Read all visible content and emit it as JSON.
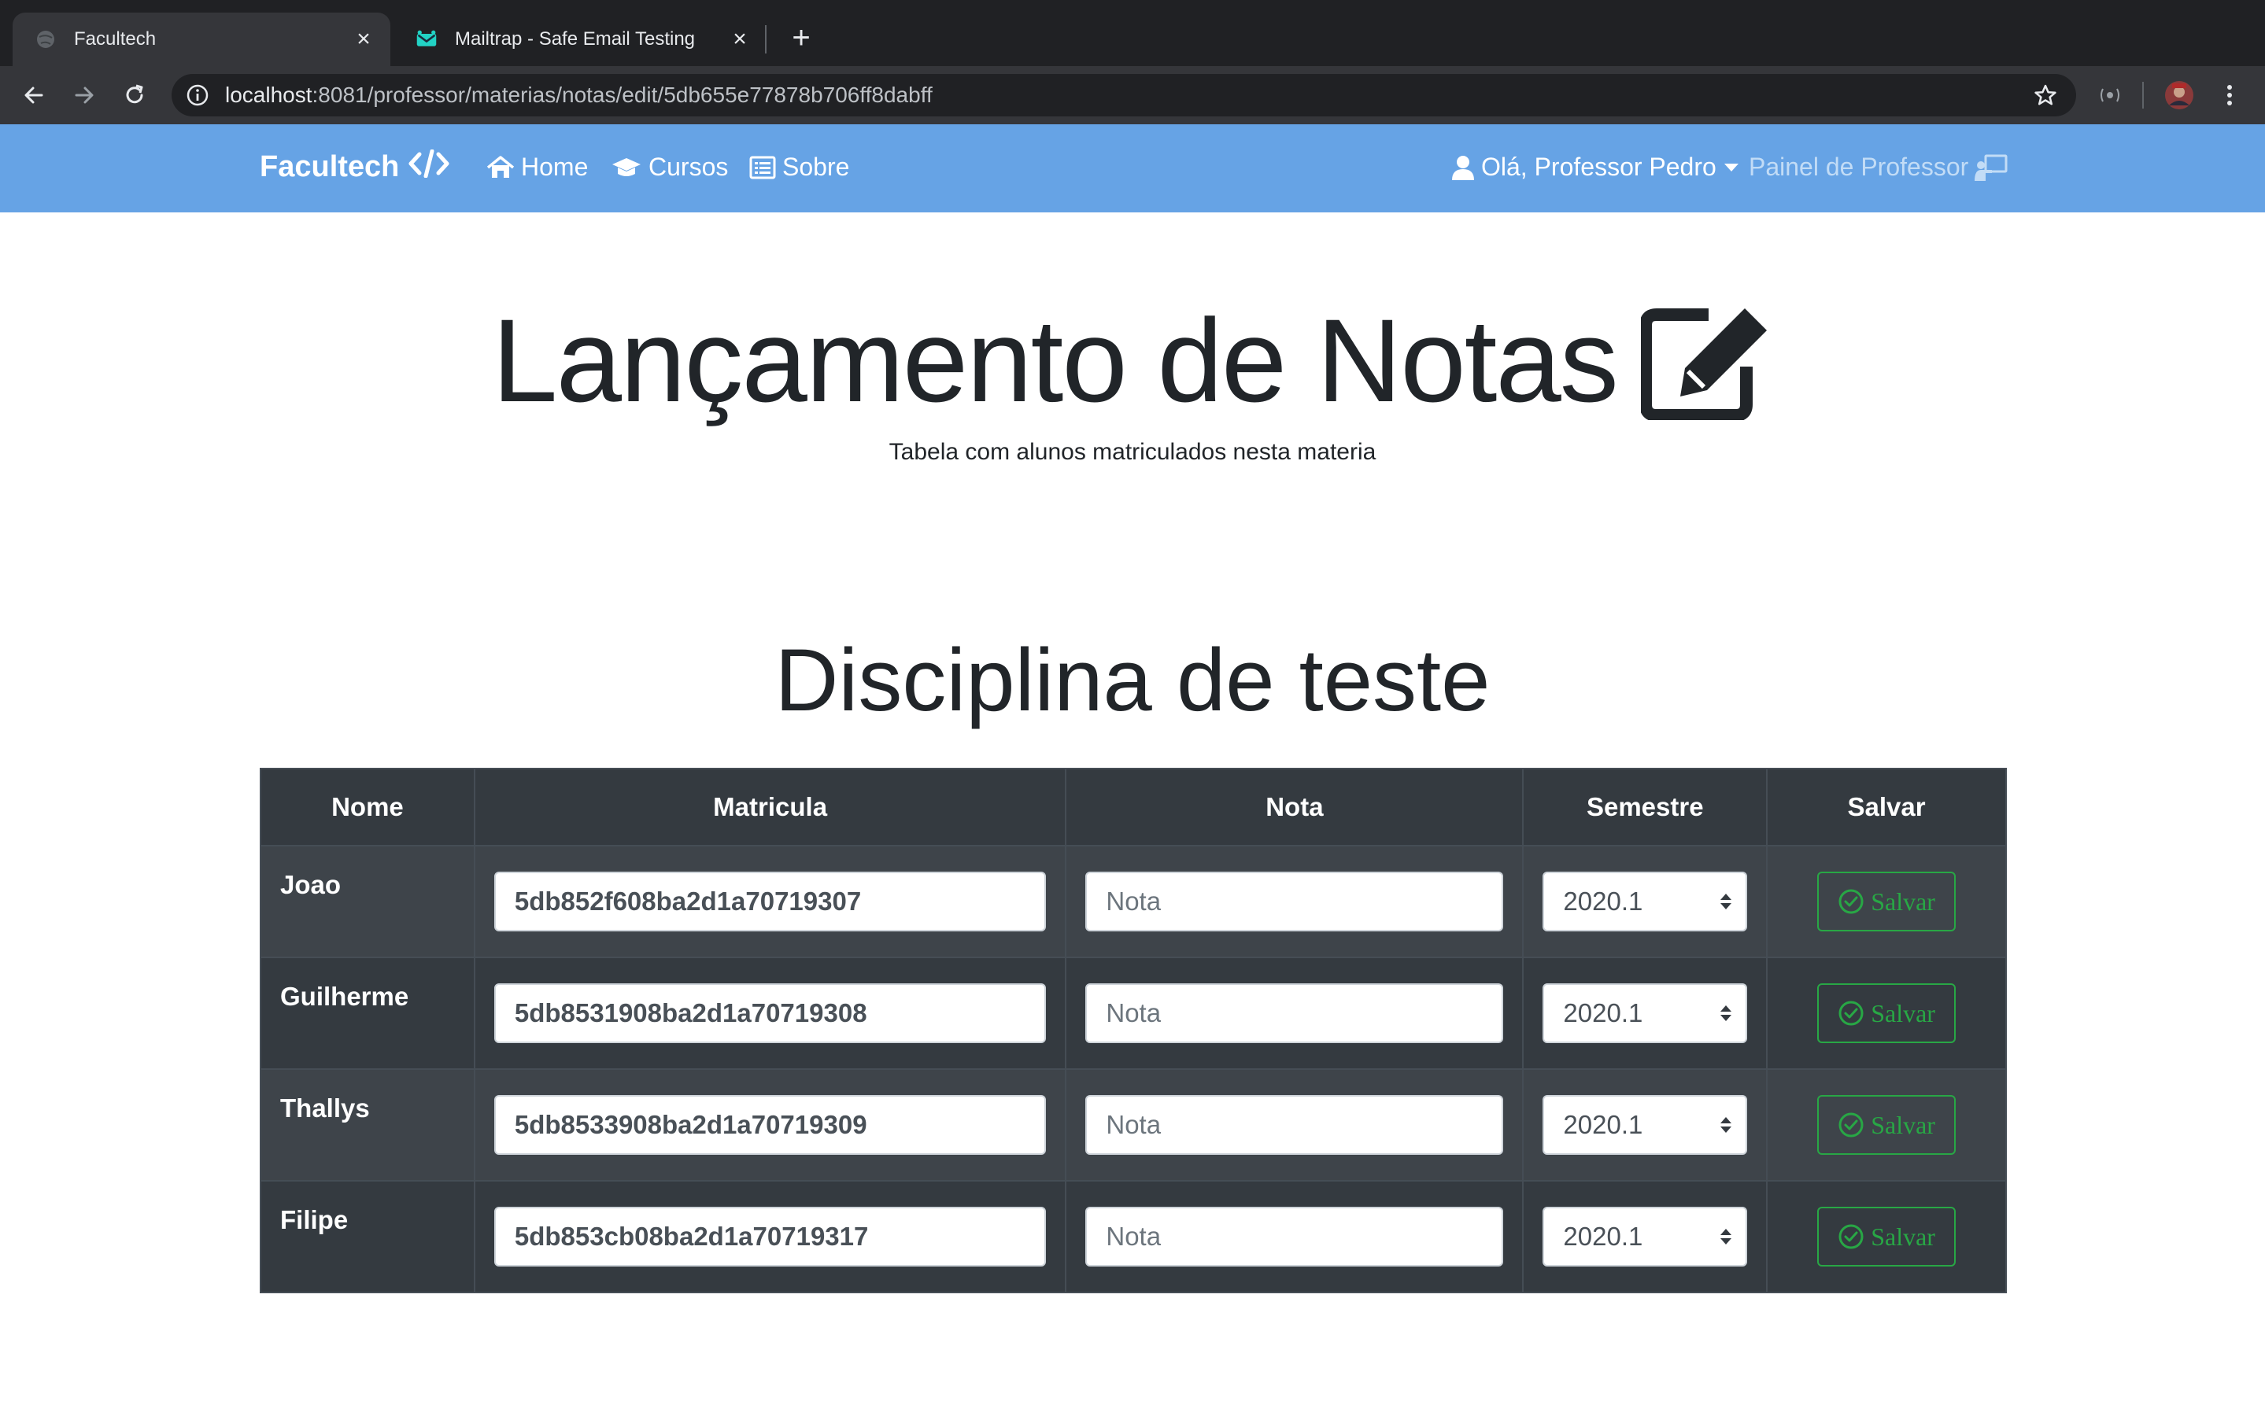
{
  "browser": {
    "tabs": [
      {
        "title": "Facultech",
        "active": true
      },
      {
        "title": "Mailtrap - Safe Email Testing",
        "active": false
      }
    ],
    "url_host": "localhost",
    "url_rest": ":8081/professor/materias/notas/edit/5db655e77878b706ff8dabff"
  },
  "navbar": {
    "brand": "Facultech",
    "links": [
      "Home",
      "Cursos",
      "Sobre"
    ],
    "user_menu": "Olá, Professor Pedro",
    "panel_link": "Painel de Professor",
    "bg_color": "#66a3e5"
  },
  "page": {
    "title": "Lançamento de Notas",
    "subtitle": "Tabela com alunos matriculados nesta materia",
    "discipline": "Disciplina de teste"
  },
  "table": {
    "headers": [
      "Nome",
      "Matricula",
      "Nota",
      "Semestre",
      "Salvar"
    ],
    "rows": [
      {
        "name": "Joao",
        "matricula": "5db852f608ba2d1a70719307",
        "nota_placeholder": "Nota",
        "semestre": "2020.1",
        "save": "Salvar"
      },
      {
        "name": "Guilherme",
        "matricula": "5db8531908ba2d1a70719308",
        "nota_placeholder": "Nota",
        "semestre": "2020.1",
        "save": "Salvar"
      },
      {
        "name": "Thallys",
        "matricula": "5db8533908ba2d1a70719309",
        "nota_placeholder": "Nota",
        "semestre": "2020.1",
        "save": "Salvar"
      },
      {
        "name": "Filipe",
        "matricula": "5db853cb08ba2d1a70719317",
        "nota_placeholder": "Nota",
        "semestre": "2020.1",
        "save": "Salvar"
      }
    ]
  }
}
